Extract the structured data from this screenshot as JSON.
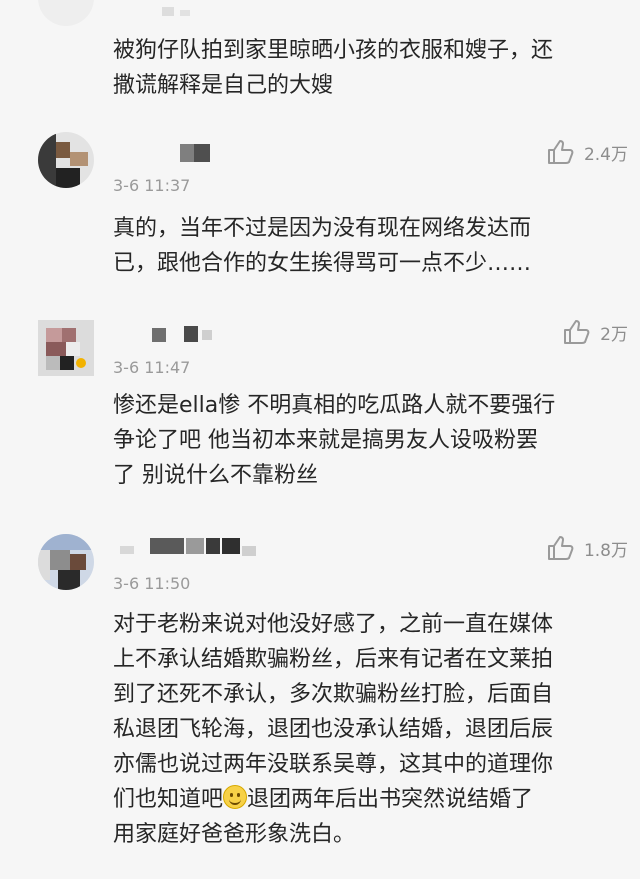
{
  "comments": [
    {
      "text": "被狗仔队拍到家里晾晒小孩的衣服和嫂子，还\n撒谎解释是自己的大嫂"
    },
    {
      "time": "3-6 11:37",
      "likes": "2.4万",
      "text": "真的，当年不过是因为没有现在网络发达而\n已，跟他合作的女生挨得骂可一点不少……"
    },
    {
      "time": "3-6 11:47",
      "likes": "2万",
      "text": "惨还是ella惨 不明真相的吃瓜路人就不要强行\n争论了吧 他当初本来就是搞男友人设吸粉罢\n了 别说什么不靠粉丝"
    },
    {
      "time": "3-6 11:50",
      "likes": "1.8万",
      "text_part1": "对于老粉来说对他没好感了，之前一直在媒体\n上不承认结婚欺骗粉丝，后来有记者在文莱拍\n到了还死不承认，多次欺骗粉丝打脸，后面自\n私退团飞轮海，退团也没承认结婚，退团后辰\n亦儒也说过两年没联系吴尊，这其中的道理你\n们也知道吧",
      "emoji": "smile-emoji",
      "text_part2": "退团两年后出书突然说结婚了\n用家庭好爸爸形象洗白。"
    }
  ],
  "icons": {
    "like": "thumbs-up-icon"
  },
  "colors": {
    "background": "#f6f6f6",
    "meta": "#9a9a9a",
    "text": "#262626"
  }
}
